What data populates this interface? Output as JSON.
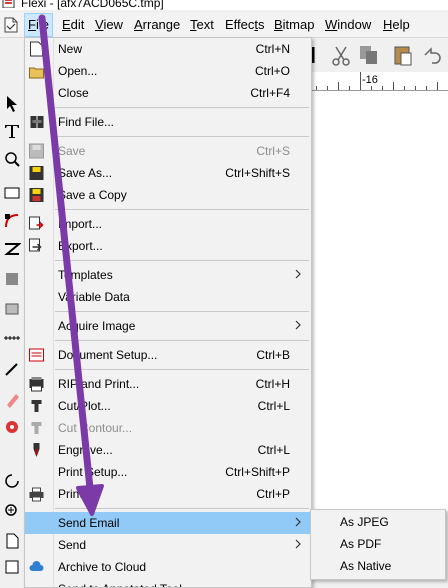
{
  "window": {
    "title": "Flexi - [afx7ACD065C.tmp]"
  },
  "menubar": {
    "items": [
      {
        "label": "File",
        "mnemonic_index": 0,
        "active": true
      },
      {
        "label": "Edit",
        "mnemonic_index": 0
      },
      {
        "label": "View",
        "mnemonic_index": 0
      },
      {
        "label": "Arrange",
        "mnemonic_index": 0
      },
      {
        "label": "Text",
        "mnemonic_index": 0
      },
      {
        "label": "Effects",
        "mnemonic_index": 5
      },
      {
        "label": "Bitmap",
        "mnemonic_index": 0
      },
      {
        "label": "Window",
        "mnemonic_index": 0
      },
      {
        "label": "Help",
        "mnemonic_index": 0
      }
    ]
  },
  "ruler": {
    "label": "-16"
  },
  "file_menu": {
    "items": [
      {
        "label": "New",
        "shortcut": "Ctrl+N",
        "icon": "new-document-icon"
      },
      {
        "label": "Open...",
        "shortcut": "Ctrl+O",
        "icon": "open-folder-icon"
      },
      {
        "label": "Close",
        "shortcut": "Ctrl+F4"
      },
      {
        "label": "Find File...",
        "icon": "find-file-icon"
      },
      {
        "label": "Save",
        "shortcut": "Ctrl+S",
        "icon": "save-icon",
        "disabled": true
      },
      {
        "label": "Save As...",
        "shortcut": "Ctrl+Shift+S",
        "icon": "save-as-icon"
      },
      {
        "label": "Save a Copy",
        "icon": "save-copy-icon"
      },
      {
        "label": "Import...",
        "icon": "import-icon"
      },
      {
        "label": "Export...",
        "icon": "export-icon"
      },
      {
        "label": "Templates",
        "submenu": true
      },
      {
        "label": "Variable Data"
      },
      {
        "label": "Acquire Image",
        "submenu": true
      },
      {
        "label": "Document Setup...",
        "shortcut": "Ctrl+B",
        "icon": "document-setup-icon"
      },
      {
        "label": "RIP and Print...",
        "shortcut": "Ctrl+H",
        "icon": "rip-print-icon"
      },
      {
        "label": "Cut/Plot...",
        "shortcut": "Ctrl+L",
        "icon": "cut-plot-icon"
      },
      {
        "label": "Cut Contour...",
        "icon": "cut-contour-icon",
        "disabled": true
      },
      {
        "label": "Engrave...",
        "shortcut": "Ctrl+L",
        "icon": "engrave-icon"
      },
      {
        "label": "Print Setup...",
        "shortcut": "Ctrl+Shift+P"
      },
      {
        "label": "Print...",
        "shortcut": "Ctrl+P",
        "icon": "printer-icon"
      },
      {
        "label": "Send Email",
        "submenu": true,
        "highlighted": true
      },
      {
        "label": "Send",
        "submenu": true
      },
      {
        "label": "Archive to Cloud",
        "icon": "cloud-icon"
      },
      {
        "label": "Send to Annotated Tool"
      }
    ]
  },
  "send_email_submenu": {
    "items": [
      {
        "label": "As JPEG"
      },
      {
        "label": "As PDF"
      },
      {
        "label": "As Native"
      }
    ]
  },
  "colors": {
    "menu_bg": "#f2f2f2",
    "highlight": "#91c9f7",
    "menubar_active": "#cce8ff",
    "annotation_arrow": "#7b3aa8",
    "disabled_text": "#8d8d8d"
  }
}
